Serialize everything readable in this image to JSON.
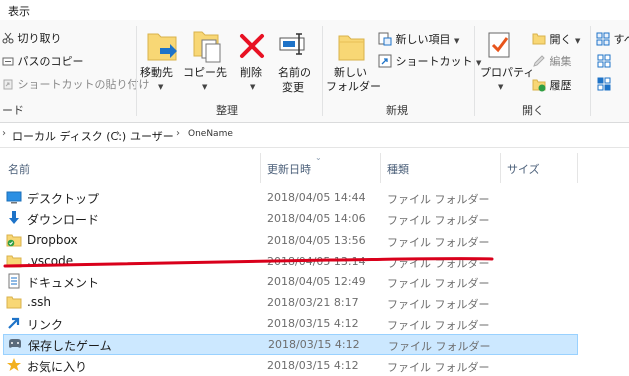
{
  "menu": {
    "view_tab": "表示"
  },
  "ribbon": {
    "clipboard": {
      "cut": "切り取り",
      "copy_path": "パスのコピー",
      "paste_shortcut": "ショートカットの貼り付け",
      "partial_group_label": "ード"
    },
    "organize": {
      "label": "整理",
      "move_to": "移動先",
      "copy_to": "コピー先",
      "delete": "削除",
      "rename_line1": "名前の",
      "rename_line2": "変更"
    },
    "new": {
      "label": "新規",
      "new_folder_line1": "新しい",
      "new_folder_line2": "フォルダー",
      "new_item": "新しい項目",
      "shortcut": "ショートカット"
    },
    "open": {
      "label": "開く",
      "properties": "プロパティ",
      "open": "開く",
      "edit": "編集",
      "history": "履歴"
    },
    "select": {
      "partial": "すべ"
    }
  },
  "address": {
    "crumbs": [
      "ローカル ディスク (C:)",
      "ユーザー",
      "OneName"
    ],
    "separator": "›"
  },
  "columns": {
    "name": "名前",
    "date": "更新日時",
    "type": "種類",
    "size": "サイズ"
  },
  "files": [
    {
      "name": "デスクトップ",
      "date": "2018/04/05 14:44",
      "type": "ファイル フォルダー",
      "icon": "desktop-folder-icon"
    },
    {
      "name": "ダウンロード",
      "date": "2018/04/05 14:06",
      "type": "ファイル フォルダー",
      "icon": "downloads-folder-icon"
    },
    {
      "name": "Dropbox",
      "date": "2018/04/05 13:56",
      "type": "ファイル フォルダー",
      "icon": "dropbox-folder-icon"
    },
    {
      "name": ".vscode",
      "date": "2018/04/05 13:14",
      "type": "ファイル フォルダー",
      "icon": "folder-icon"
    },
    {
      "name": "ドキュメント",
      "date": "2018/04/05 12:49",
      "type": "ファイル フォルダー",
      "icon": "documents-folder-icon"
    },
    {
      "name": ".ssh",
      "date": "2018/03/21 8:17",
      "type": "ファイル フォルダー",
      "icon": "folder-icon"
    },
    {
      "name": "リンク",
      "date": "2018/03/15 4:12",
      "type": "ファイル フォルダー",
      "icon": "links-folder-icon"
    },
    {
      "name": "保存したゲーム",
      "date": "2018/03/15 4:12",
      "type": "ファイル フォルダー",
      "icon": "saved-games-folder-icon"
    },
    {
      "name": "お気に入り",
      "date": "2018/03/15 4:12",
      "type": "ファイル フォルダー",
      "icon": "favorites-folder-icon"
    }
  ],
  "colors": {
    "selection": "#cce8ff",
    "selection_border": "#99d1ff",
    "annotation_line": "#d9001b",
    "folder_yellow": "#f8d775",
    "delete_red": "#e81123",
    "header_text": "#4c607a"
  }
}
